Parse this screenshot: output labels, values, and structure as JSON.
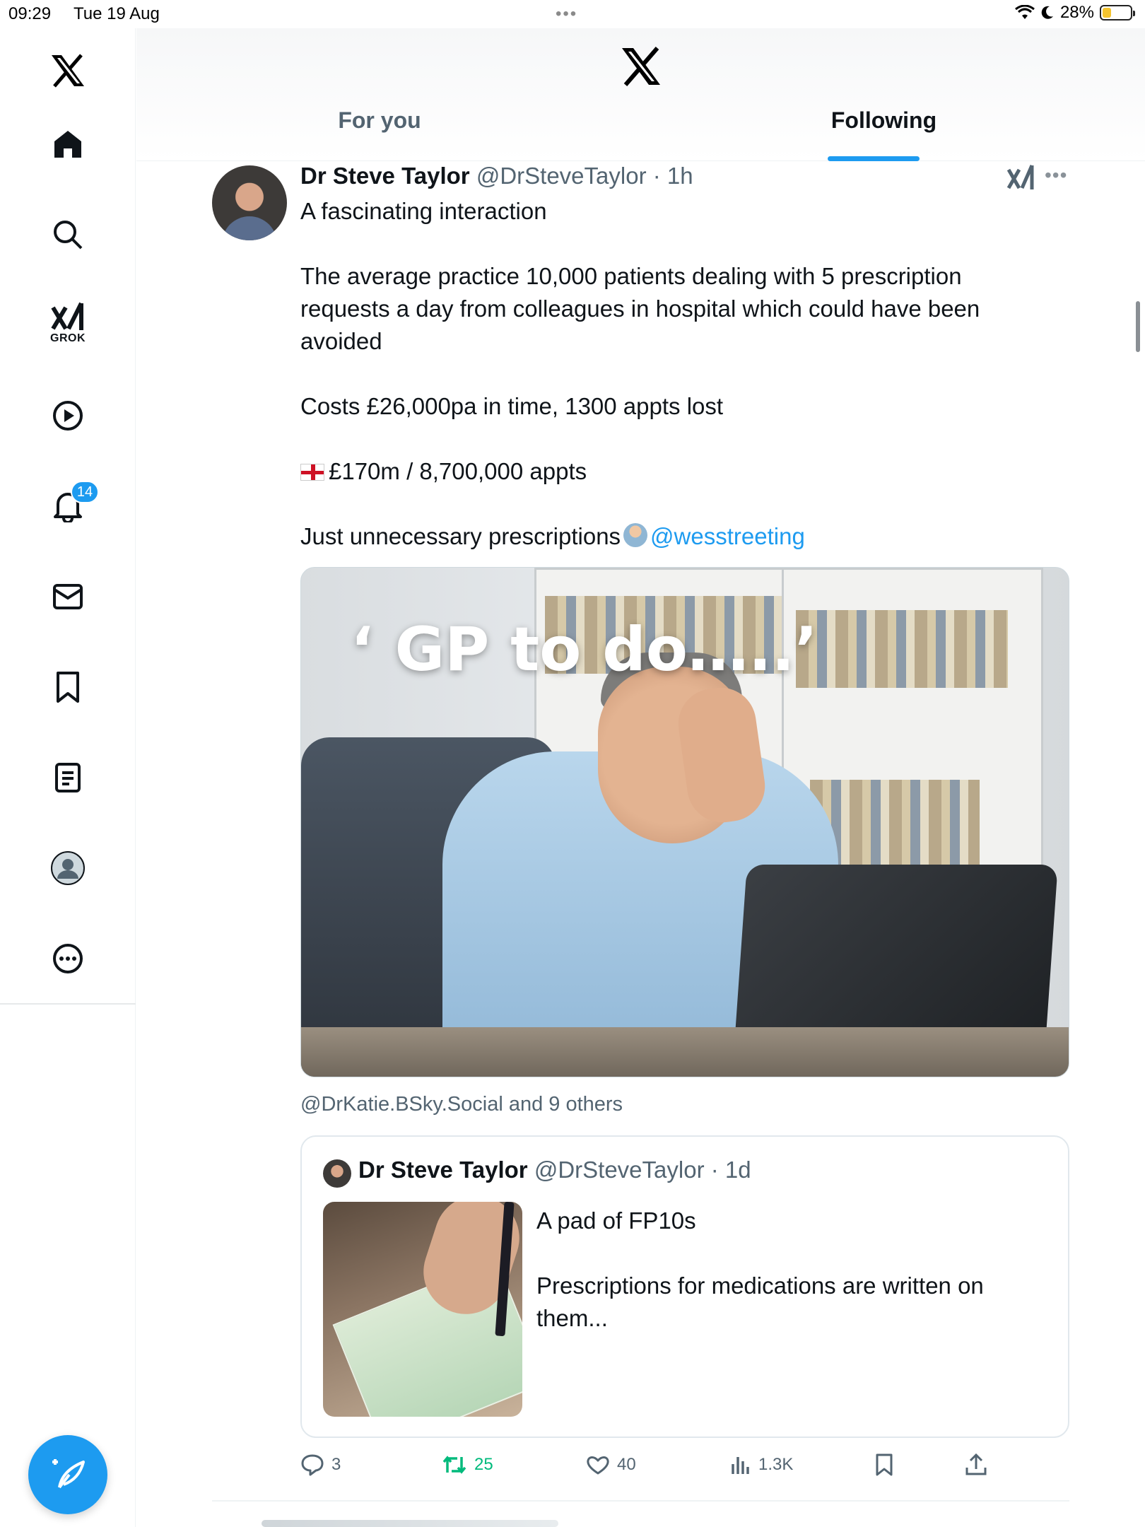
{
  "status_bar": {
    "time": "09:29",
    "date": "Tue 19 Aug",
    "dots": "•••",
    "battery_percent": "28%"
  },
  "sidebar": {
    "items": [
      {
        "name": "x-logo-icon"
      },
      {
        "name": "home-icon"
      },
      {
        "name": "search-icon"
      },
      {
        "name": "grok-icon",
        "label": "GROK"
      },
      {
        "name": "video-icon"
      },
      {
        "name": "notifications-icon",
        "badge": "14"
      },
      {
        "name": "messages-icon"
      },
      {
        "name": "bookmarks-icon"
      },
      {
        "name": "lists-icon"
      },
      {
        "name": "profile-icon"
      },
      {
        "name": "more-icon"
      }
    ]
  },
  "header": {
    "tabs": [
      {
        "label": "For you",
        "active": false
      },
      {
        "label": "Following",
        "active": true
      }
    ]
  },
  "tweet": {
    "author_name": "Dr Steve Taylor",
    "author_handle": "@DrSteveTaylor",
    "time": " · 1h",
    "lines": {
      "l1": "A fascinating interaction",
      "l2": "The average practice 10,000 patients dealing with 5 prescription",
      "l3": "requests a day from colleagues in hospital which could have been",
      "l4": "avoided",
      "l5": "Costs £26,000pa in time, 1300 appts lost",
      "l6": "£170m / 8,700,000 appts",
      "l7": "Just unnecessary prescriptions",
      "mention": "@wesstreeting"
    },
    "media_overlay_text": "‘ GP to do…..’",
    "tagged": "@DrKatie.BSky.Social and 9 others"
  },
  "quote": {
    "author_name": "Dr Steve Taylor",
    "author_handle": "@DrSteveTaylor",
    "time": " · 1d",
    "line1": "A pad of FP10s",
    "line2": "Prescriptions for medications are written on",
    "line3": "them..."
  },
  "actions": {
    "replies": "3",
    "reposts": "25",
    "likes": "40",
    "views": "1.3K"
  },
  "colors": {
    "accent": "#1d9bf0",
    "repost_green": "#00ba7c",
    "secondary_text": "#536471"
  }
}
